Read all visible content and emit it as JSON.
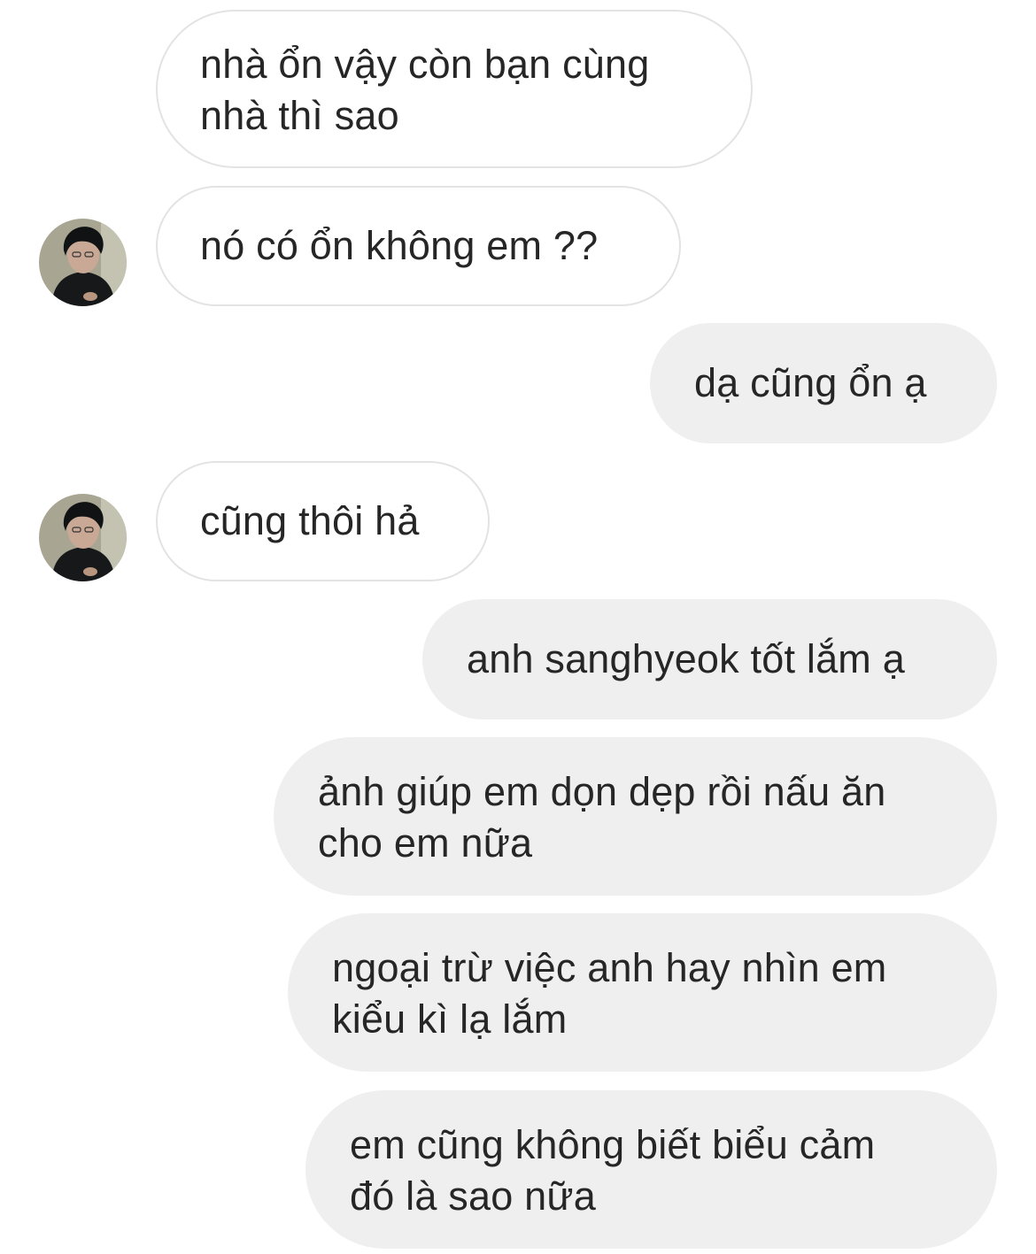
{
  "messages": [
    {
      "sender": "them",
      "text": "nhà ổn vậy còn bạn cùng\nnhà thì sao"
    },
    {
      "sender": "them",
      "text": "nó có ổn không em ??"
    },
    {
      "sender": "me",
      "text": "dạ cũng ổn ạ"
    },
    {
      "sender": "them",
      "text": "cũng thôi hả"
    },
    {
      "sender": "me",
      "text": "anh sanghyeok tốt lắm ạ"
    },
    {
      "sender": "me",
      "text": "ảnh giúp em dọn dẹp rồi nấu ăn\ncho em nữa"
    },
    {
      "sender": "me",
      "text": "ngoại trừ việc anh hay nhìn em\nkiểu kì lạ lắm"
    },
    {
      "sender": "me",
      "text": "em cũng không biết biểu cảm\nđó là sao nữa"
    }
  ],
  "colors": {
    "incoming_bubble_bg": "#ffffff",
    "incoming_bubble_border": "#e3e3e3",
    "outgoing_bubble_bg": "#efefef",
    "text": "#262626"
  },
  "icons": {
    "avatar": "profile-photo"
  }
}
